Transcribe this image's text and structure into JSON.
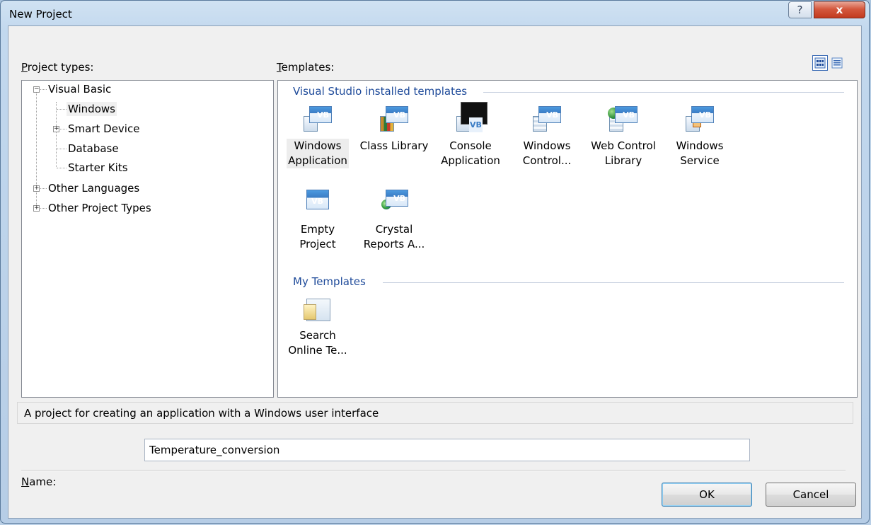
{
  "window": {
    "title": "New Project",
    "help_glyph": "?",
    "close_glyph": "x"
  },
  "project_types": {
    "label_underline": "P",
    "label_rest": "roject types:",
    "tree": [
      {
        "label": "Visual Basic",
        "expander": "−"
      },
      {
        "label": "Windows"
      },
      {
        "label": "Smart Device",
        "expander": "+"
      },
      {
        "label": "Database"
      },
      {
        "label": "Starter Kits"
      },
      {
        "label": "Other Languages",
        "expander": "+"
      },
      {
        "label": "Other Project Types",
        "expander": "+"
      }
    ]
  },
  "templates": {
    "label_underline": "T",
    "label_rest": "emplates:",
    "installed_header": "Visual Studio installed templates",
    "my_header": "My Templates",
    "installed": [
      {
        "line1": "Windows",
        "line2": "Application",
        "icon": "windows-application-icon"
      },
      {
        "line1": "Class Library",
        "line2": "",
        "icon": "class-library-icon"
      },
      {
        "line1": "Console",
        "line2": "Application",
        "icon": "console-application-icon"
      },
      {
        "line1": "Windows",
        "line2": "Control...",
        "icon": "windows-control-library-icon"
      },
      {
        "line1": "Web Control",
        "line2": "Library",
        "icon": "web-control-library-icon"
      },
      {
        "line1": "Windows",
        "line2": "Service",
        "icon": "windows-service-icon"
      },
      {
        "line1": "Empty",
        "line2": "Project",
        "icon": "empty-project-icon"
      },
      {
        "line1": "Crystal",
        "line2": "Reports A...",
        "icon": "crystal-reports-icon"
      }
    ],
    "mine": [
      {
        "line1": "Search",
        "line2": "Online Te...",
        "icon": "search-online-templates-icon"
      }
    ],
    "vb_badge": "VB"
  },
  "description": "A project for creating an application with a Windows user interface",
  "name_field": {
    "label_underline": "N",
    "label_rest": "ame:",
    "value": "Temperature_conversion"
  },
  "buttons": {
    "ok": "OK",
    "cancel": "Cancel"
  }
}
